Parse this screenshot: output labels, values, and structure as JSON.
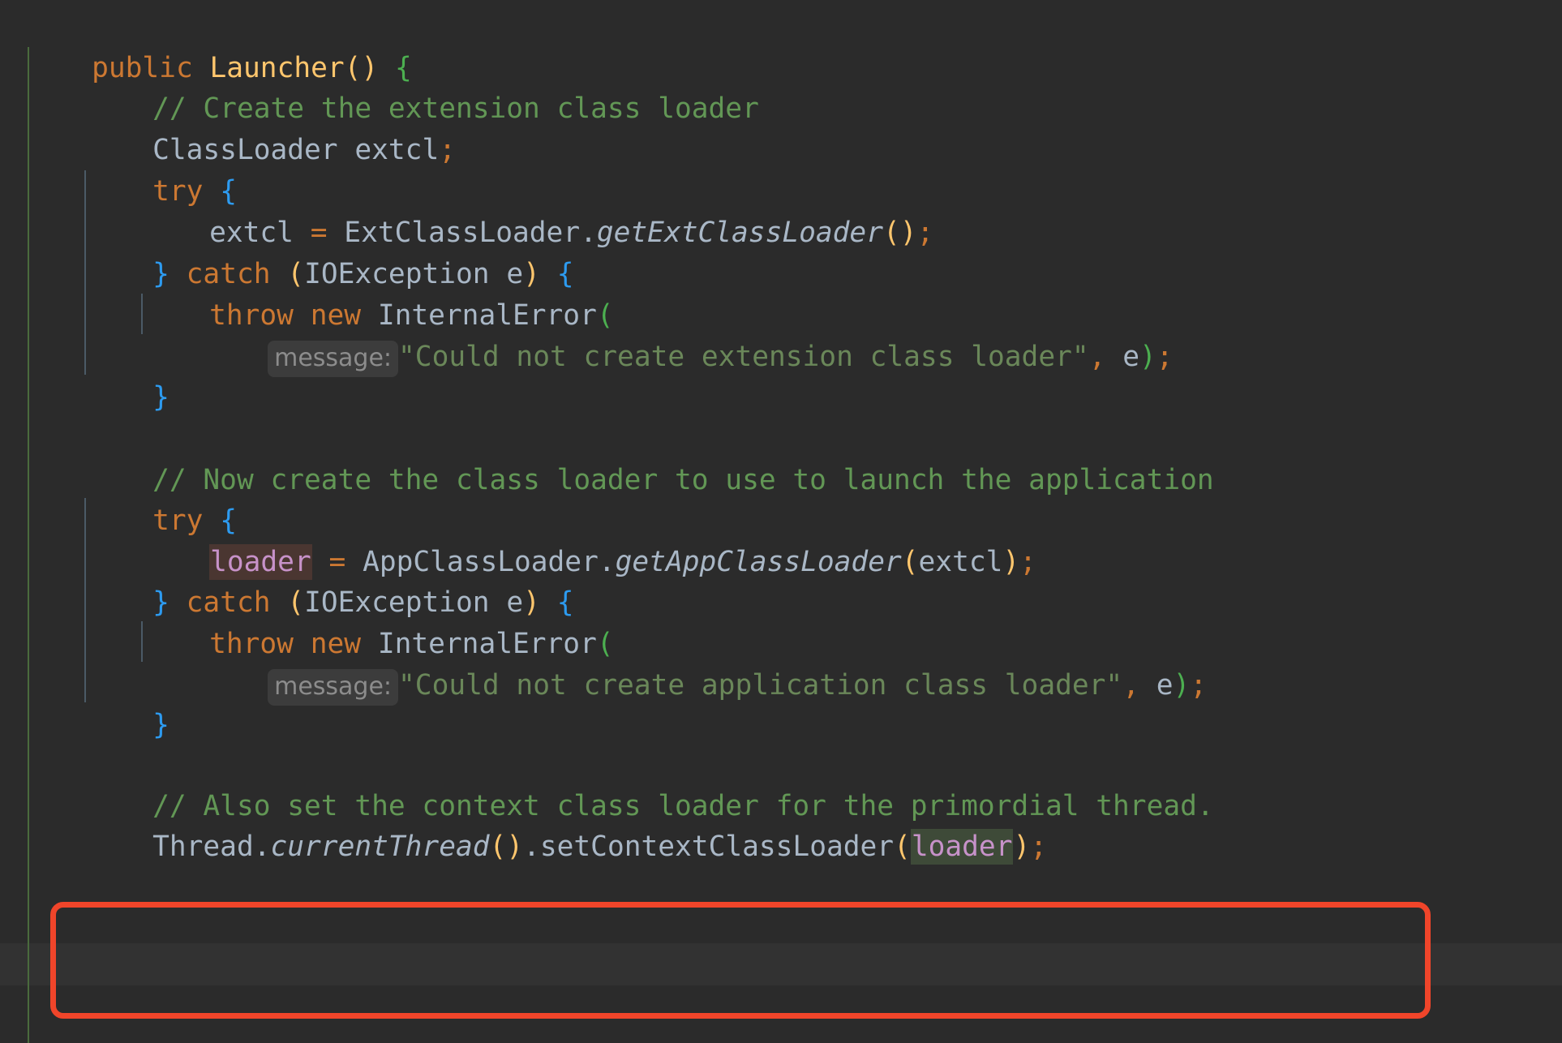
{
  "editor": {
    "language": "Java",
    "theme": "Darcula",
    "background_color": "#2B2B2B",
    "current_line_color": "#323232"
  },
  "colors": {
    "keyword": "#CC7832",
    "class_name": "#FFC66D",
    "identifier": "#A9B7C6",
    "comment": "#629755",
    "string": "#6A8759",
    "brace_level1": "#2D9BF0",
    "paren_level2": "#4CAF50",
    "paren_level3": "#FFC66D",
    "operator": "#CC7832",
    "hint_background": "#3C3C3C",
    "hint_text": "#8C8C8C",
    "highlight_write_bg": "#4A3631",
    "highlight_read_bg": "#3E4A38",
    "highlight_text": "#C792C9",
    "annotation_border": "#F0452A",
    "indent_guide_green": "#4A6B3D",
    "indent_guide_blue": "#4B5A66"
  },
  "code": {
    "signature": {
      "modifier": "public",
      "name": "Launcher",
      "parens": "()",
      "open_brace": "{"
    },
    "comment_1": "// Create the extension class loader",
    "decl_type": "ClassLoader",
    "decl_name": "extcl",
    "decl_semi": ";",
    "try_1": "try",
    "try_1_brace": "{",
    "assign_1": {
      "target": "extcl",
      "equals": "=",
      "class": "ExtClassLoader",
      "dot": ".",
      "method": "getExtClassLoader",
      "open_paren": "(",
      "close_paren": ")",
      "semi": ";"
    },
    "catch_1": {
      "close_brace": "}",
      "keyword": "catch",
      "open_paren": "(",
      "exception_type": "IOException",
      "var": "e",
      "close_paren": ")",
      "open_brace": "{"
    },
    "throw_1": {
      "throw": "throw",
      "new": "new",
      "type": "InternalError",
      "open_paren": "("
    },
    "msg_1": {
      "hint": "message:",
      "string": "\"Could not create extension class loader\"",
      "comma": ",",
      "arg": "e",
      "close_paren": ")",
      "semi": ";"
    },
    "close_brace_1": "}",
    "comment_2": "// Now create the class loader to use to launch the application",
    "try_2": "try",
    "try_2_brace": "{",
    "assign_2": {
      "target": "loader",
      "equals": "=",
      "class": "AppClassLoader",
      "dot": ".",
      "method": "getAppClassLoader",
      "open_paren": "(",
      "arg": "extcl",
      "close_paren": ")",
      "semi": ";"
    },
    "catch_2": {
      "close_brace": "}",
      "keyword": "catch",
      "open_paren": "(",
      "exception_type": "IOException",
      "var": "e",
      "close_paren": ")",
      "open_brace": "{"
    },
    "throw_2": {
      "throw": "throw",
      "new": "new",
      "type": "InternalError",
      "open_paren": "("
    },
    "msg_2": {
      "hint": "message:",
      "string": "\"Could not create application class loader\"",
      "comma": ",",
      "arg": "e",
      "close_paren": ")",
      "semi": ";"
    },
    "close_brace_2": "}",
    "comment_3": "// Also set the context class loader for the primordial thread.",
    "set_ctx": {
      "receiver": "Thread",
      "dot1": ".",
      "method1": "currentThread",
      "open_paren1": "(",
      "close_paren1": ")",
      "dot2": ".",
      "method2": "setContextClassLoader",
      "open_paren2": "(",
      "arg": "loader",
      "close_paren2": ")",
      "semi": ";"
    }
  },
  "annotation": {
    "shape": "rounded-rectangle",
    "color": "#F0452A",
    "border_width_px": 7,
    "covers_lines": 2
  }
}
